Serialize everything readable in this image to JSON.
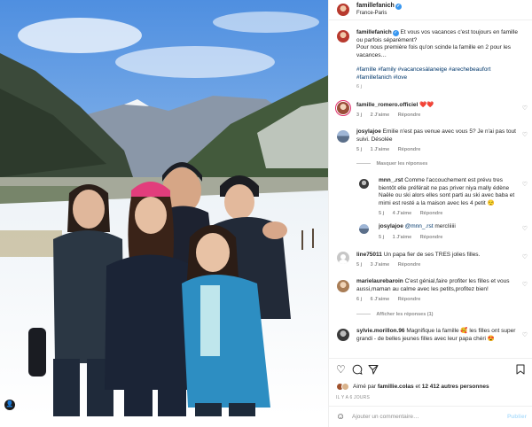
{
  "header": {
    "username": "famillefanich",
    "location": "France-Paris",
    "more_icon": "ellipsis-icon"
  },
  "caption": {
    "username": "famillefanich",
    "text": "Et vous vos vacances c'est toujours en famille ou parfois séparément?",
    "text2": "Pour nous première fois qu'on scinde la famille en 2 pour les vacances…",
    "hashtags": "#famille #family #vacancesàlaneige #arechebeaufort #famillefanich #love",
    "time": "6 j"
  },
  "comments": [
    {
      "username": "famille_romero.officiel",
      "text": "❤️❤️",
      "time": "3 j",
      "likes": "2 J'aime",
      "reply": "Répondre"
    },
    {
      "username": "josylajoe",
      "text": "Emilie n'est pas venue avec vous 5? Je n'ai pas tout suivi. Désolée",
      "time": "5 j",
      "likes": "1 J'aime",
      "reply": "Répondre"
    },
    {
      "username": "line75011",
      "text": "Un papa fier de ses TRES jolies filles.",
      "time": "5 j",
      "likes": "3 J'aime",
      "reply": "Répondre"
    },
    {
      "username": "marielaurebaroin",
      "text": "C'est génial,faire profiter les filles et vous aussi,maman au calme avec les petits,profitez bien!",
      "time": "6 j",
      "likes": "6 J'aime",
      "reply": "Répondre"
    },
    {
      "username": "sylvie.morillon.96",
      "text": "Magnifique la famille 🥰 les filles ont super grandi - de belles jeunes filles avec leur papa chéri 😍",
      "time": "",
      "likes": "",
      "reply": ""
    }
  ],
  "replies_toggle": {
    "hide": "Masquer les réponses",
    "show": "Afficher les réponses (1)"
  },
  "replies": [
    {
      "username": "mnn_.rst",
      "text": "Comme l'accouchement est prévu tres bientôt elle préférait ne pas priver niya mally édène Naële ou ski alors elles sont parti au ski avec baba et mimi est resté a la maison avec les 4 petit 😌",
      "time": "5 j",
      "likes": "4 J'aime",
      "reply": "Répondre"
    },
    {
      "username": "josylajoe",
      "mention": "@mnn_.rst",
      "text": "mercIiiiii",
      "time": "5 j",
      "likes": "1 J'aime",
      "reply": "Répondre"
    }
  ],
  "actions": {
    "like_icon": "heart-icon",
    "comment_icon": "comment-icon",
    "share_icon": "share-icon",
    "save_icon": "bookmark-icon"
  },
  "likes": {
    "prefix": "Aimé par ",
    "user": "famillie.colas",
    "middle": " et ",
    "count": "12 412 autres personnes"
  },
  "date": "IL Y A 6 JOURS",
  "add_comment": {
    "placeholder": "Ajouter un commentaire…",
    "post_label": "Publier"
  },
  "colors": {
    "link": "#00376b",
    "muted": "#8e8e8e",
    "verified": "#3897f0",
    "post_disabled": "#b2dffc"
  }
}
